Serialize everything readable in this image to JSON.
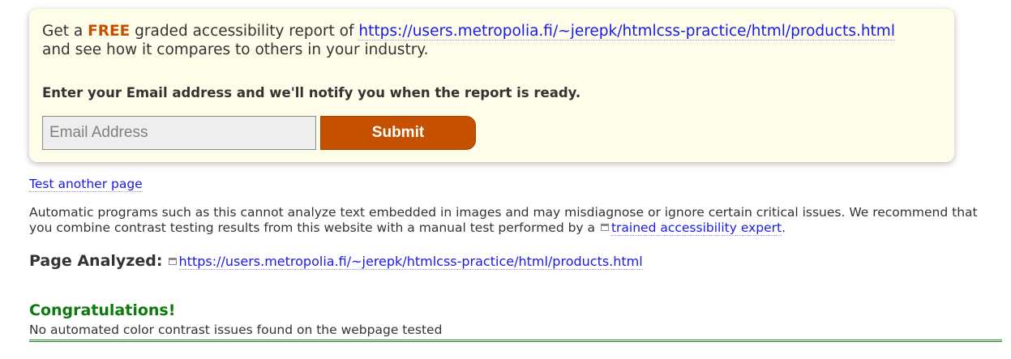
{
  "promo": {
    "text_before_free": "Get a ",
    "free_label": "FREE",
    "text_after_free": " graded accessibility report of ",
    "report_url": "https://users.metropolia.fi/~jerepk/htmlcss-practice/html/products.html",
    "text_line2": "and see how it compares to others in your industry.",
    "notify_text": "Enter your Email address and we'll notify you when the report is ready.",
    "email_placeholder": "Email Address",
    "email_value": "",
    "submit_label": "Submit"
  },
  "test_another_label": "Test another page",
  "disclaimer": {
    "text": "Automatic programs such as this cannot analyze text embedded in images and may misdiagnose or ignore certain critical issues. We recommend that you combine contrast testing results from this website with a manual test performed by a ",
    "expert_link": "trained accessibility expert",
    "end": "."
  },
  "page_analyzed": {
    "label": "Page Analyzed:",
    "url": "https://users.metropolia.fi/~jerepk/htmlcss-practice/html/products.html"
  },
  "result": {
    "title": "Congratulations!",
    "message": "No automated color contrast issues found on the webpage tested"
  },
  "colors": {
    "accent": "#c45000",
    "link": "#1a1ae6",
    "success": "#0b7a0b",
    "panel_bg": "#fdfde9"
  },
  "icons": {
    "external_link": "external-link-icon"
  }
}
